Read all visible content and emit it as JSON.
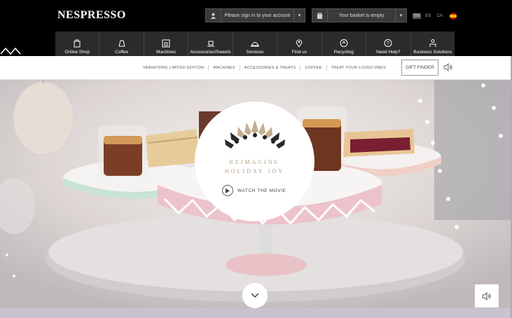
{
  "header": {
    "logo": "NESPRESSO",
    "signin_label": "Please sign in to your account",
    "basket_label": "Your basket is empty",
    "languages": [
      "EN",
      "ES",
      "CA"
    ],
    "active_language": "EN"
  },
  "nav": [
    {
      "label": "Online Shop",
      "icon": "shopping-bag-icon"
    },
    {
      "label": "Coffee",
      "icon": "coffee-capsule-icon"
    },
    {
      "label": "Machines",
      "icon": "coffee-machine-icon"
    },
    {
      "label": "Accessories/Sweets",
      "icon": "cup-saucer-icon"
    },
    {
      "label": "Services",
      "icon": "service-bell-icon"
    },
    {
      "label": "Find us",
      "icon": "location-pin-icon"
    },
    {
      "label": "Recycling",
      "icon": "recycle-icon"
    },
    {
      "label": "Need Help?",
      "icon": "help-icon"
    },
    {
      "label": "Business Solutions",
      "icon": "business-people-icon"
    }
  ],
  "subnav": {
    "links": [
      "VARIATIONS LIMITED EDITION",
      "MACHINES",
      "ACCESSORIES & TREATS",
      "COFFEE",
      "TREAT YOUR LOVED ONES"
    ],
    "gift_finder": "GIFT FINDER"
  },
  "hero": {
    "title_line1": "REIMAGINE",
    "title_line2": "HOLIDAY JOY",
    "watch_label": "WATCH THE MOVIE"
  },
  "colors": {
    "header_bg": "#000000",
    "nav_bg": "#2b2b2b",
    "title_gold": "#b29a80",
    "stand_pink": "#e9c2c8",
    "stand_mint": "#c9e3d4"
  }
}
